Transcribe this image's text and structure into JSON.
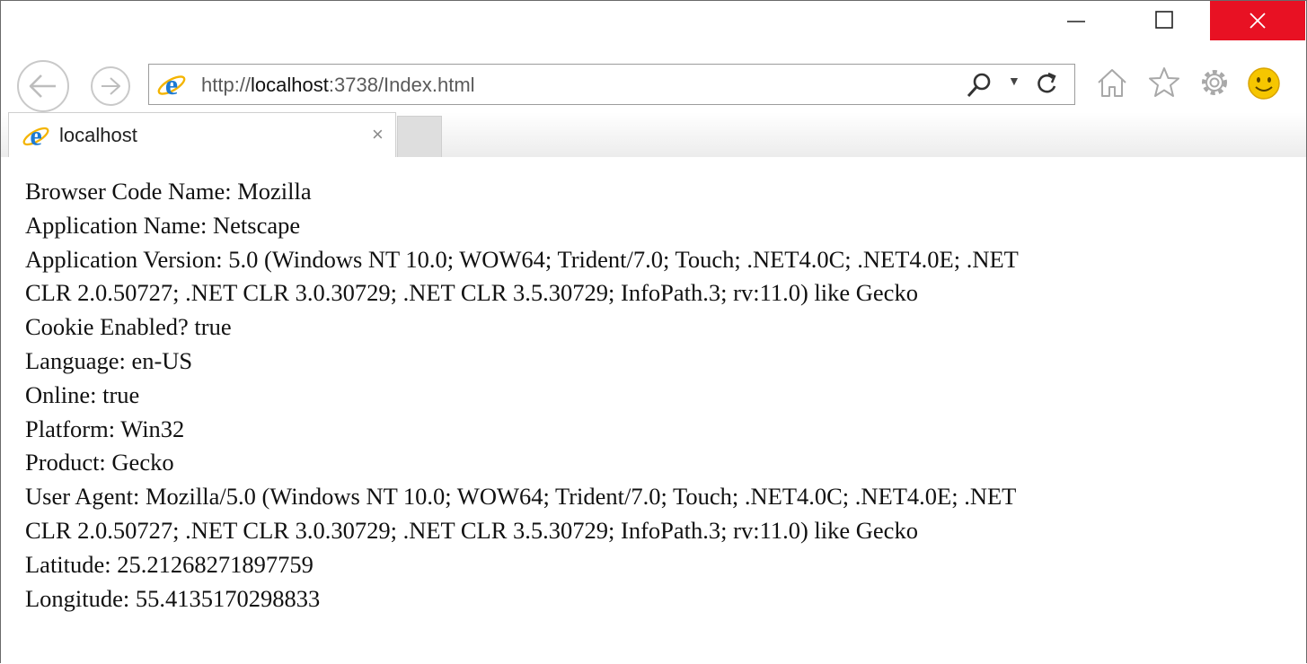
{
  "address_bar": {
    "url_prefix": "http://",
    "url_host": "localhost",
    "url_rest": ":3738/Index.html"
  },
  "tab": {
    "title": "localhost",
    "close_glyph": "×"
  },
  "icons": {
    "back": "back-arrow-icon",
    "forward": "forward-arrow-icon",
    "search": "search-icon",
    "refresh": "refresh-icon",
    "home": "home-icon",
    "favorites": "star-icon",
    "settings": "gear-icon",
    "feedback": "smiley-icon"
  },
  "content": {
    "line1": "Browser Code Name: Mozilla",
    "line2": "Application Name: Netscape",
    "line3": "Application Version: 5.0 (Windows NT 10.0; WOW64; Trident/7.0; Touch; .NET4.0C; .NET4.0E; .NET",
    "line4": "CLR 2.0.50727; .NET CLR 3.0.30729; .NET CLR 3.5.30729; InfoPath.3; rv:11.0) like Gecko",
    "line5": "Cookie Enabled? true",
    "line6": "Language: en-US",
    "line7": "Online: true",
    "line8": "Platform: Win32",
    "line9": "Product: Gecko",
    "line10": "User Agent: Mozilla/5.0 (Windows NT 10.0; WOW64; Trident/7.0; Touch; .NET4.0C; .NET4.0E; .NET",
    "line11": "CLR 2.0.50727; .NET CLR 3.0.30729; .NET CLR 3.5.30729; InfoPath.3; rv:11.0) like Gecko",
    "line12": "Latitude: 25.21268271897759",
    "line13": "Longitude: 55.4135170298833"
  },
  "colors": {
    "close_button": "#e81123",
    "ie_logo": "#1d7ad3",
    "smiley": "#f6c600"
  }
}
